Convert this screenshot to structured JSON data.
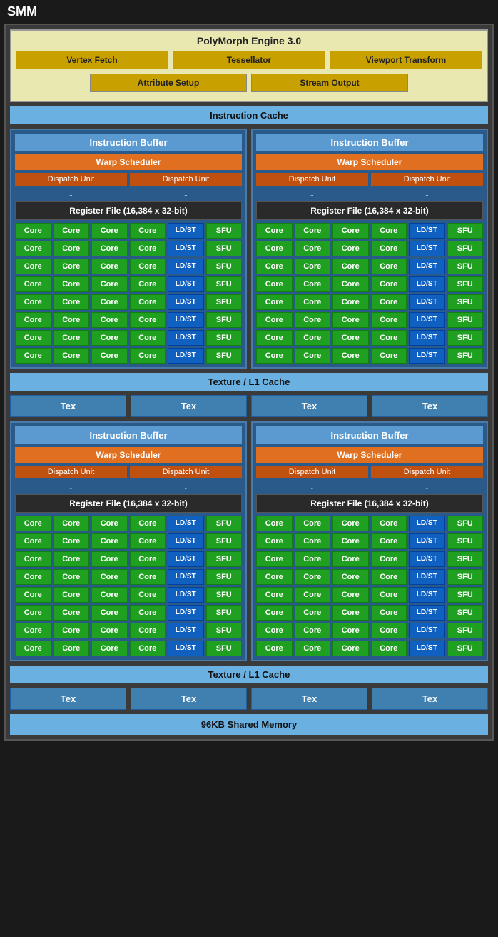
{
  "title": "SMM",
  "polymorph": {
    "title": "PolyMorph Engine 3.0",
    "row1": [
      "Vertex Fetch",
      "Tessellator",
      "Viewport Transform"
    ],
    "row2": [
      "Attribute Setup",
      "Stream Output"
    ]
  },
  "instruction_cache": "Instruction Cache",
  "sm_sections": [
    {
      "id": "top",
      "halves": [
        {
          "instruction_buffer": "Instruction Buffer",
          "warp_scheduler": "Warp Scheduler",
          "dispatch1": "Dispatch Unit",
          "dispatch2": "Dispatch Unit",
          "register_file": "Register File (16,384 x 32-bit)",
          "rows": 8,
          "core_cols": [
            "Core",
            "Core",
            "Core",
            "Core",
            "LD/ST",
            "SFU"
          ]
        },
        {
          "instruction_buffer": "Instruction Buffer",
          "warp_scheduler": "Warp Scheduler",
          "dispatch1": "Dispatch Unit",
          "dispatch2": "Dispatch Unit",
          "register_file": "Register File (16,384 x 32-bit)",
          "rows": 8,
          "core_cols": [
            "Core",
            "Core",
            "Core",
            "Core",
            "LD/ST",
            "SFU"
          ]
        }
      ]
    },
    {
      "id": "bottom",
      "halves": [
        {
          "instruction_buffer": "Instruction Buffer",
          "warp_scheduler": "Warp Scheduler",
          "dispatch1": "Dispatch Unit",
          "dispatch2": "Dispatch Unit",
          "register_file": "Register File (16,384 x 32-bit)",
          "rows": 8,
          "core_cols": [
            "Core",
            "Core",
            "Core",
            "Core",
            "LD/ST",
            "SFU"
          ]
        },
        {
          "instruction_buffer": "Instruction Buffer",
          "warp_scheduler": "Warp Scheduler",
          "dispatch1": "Dispatch Unit",
          "dispatch2": "Dispatch Unit",
          "register_file": "Register File (16,384 x 32-bit)",
          "rows": 8,
          "core_cols": [
            "Core",
            "Core",
            "Core",
            "Core",
            "LD/ST",
            "SFU"
          ]
        }
      ]
    }
  ],
  "texture_l1_cache": "Texture / L1 Cache",
  "tex_units": [
    "Tex",
    "Tex",
    "Tex",
    "Tex"
  ],
  "shared_memory": "96KB Shared Memory"
}
